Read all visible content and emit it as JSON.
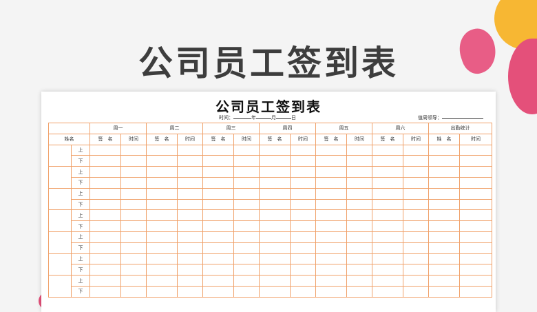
{
  "main_title": "公司员工签到表",
  "sheet_title": "公司员工签到表",
  "meta": {
    "time_label": "时间：",
    "year_label": "年",
    "month_label": "月",
    "day_label": "日",
    "leader_label": "值周领导："
  },
  "table": {
    "name_header": "姓名",
    "days": [
      "周一",
      "周二",
      "周三",
      "周四",
      "周五",
      "周六"
    ],
    "stats_header": "出勤统计",
    "sign_header": "签　名",
    "time_header": "时间",
    "stats_name_header": "姓　名",
    "stats_time_header": "时间",
    "period_labels": [
      "上",
      "下"
    ],
    "employee_groups": 7
  },
  "colors": {
    "grid_border": "#f0a068",
    "accent_yellow": "#f7b733",
    "accent_pink": "#e4507a",
    "title_text": "#3d3d3d"
  }
}
